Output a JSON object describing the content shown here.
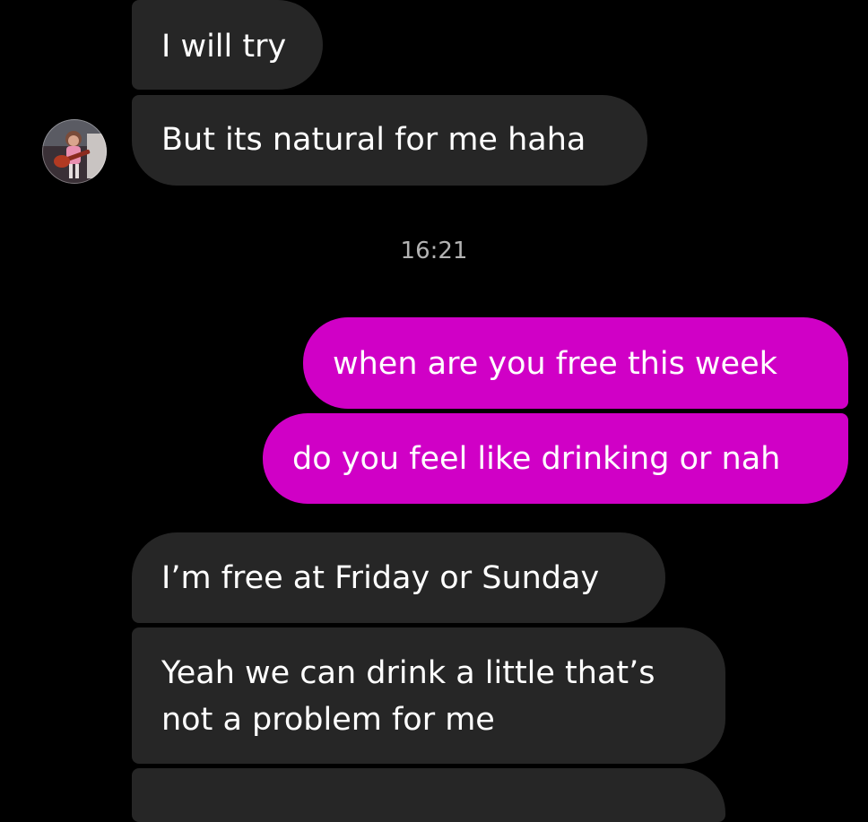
{
  "thread": {
    "messages_before_time": [
      {
        "sender": "them",
        "text": "I will try"
      },
      {
        "sender": "them",
        "text": "But its natural for me haha"
      }
    ],
    "timestamp": "16:21",
    "messages_after_time": [
      {
        "sender": "me",
        "text": "when are you free this week"
      },
      {
        "sender": "me",
        "text": "do you feel like drinking or nah"
      },
      {
        "sender": "them",
        "text": "I’m free at Friday or Sunday"
      },
      {
        "sender": "them",
        "text": "Yeah we can drink a little that’s not a problem for me"
      }
    ]
  },
  "contact": {
    "avatar_icon": "avatar-photo-icon"
  },
  "colors": {
    "background": "#000000",
    "received_bubble": "#262626",
    "sent_bubble": "#d000c6",
    "timestamp_text": "#b3b3b3",
    "message_text": "#ffffff"
  }
}
